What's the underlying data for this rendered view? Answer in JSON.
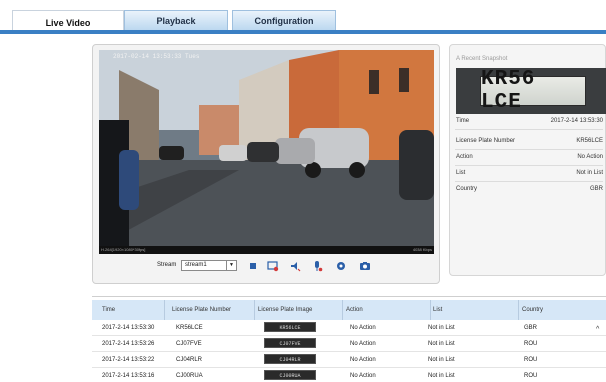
{
  "tabs": [
    {
      "label": "Live Video",
      "active": true
    },
    {
      "label": "Playback",
      "active": false
    },
    {
      "label": "Configuration",
      "active": false
    }
  ],
  "video": {
    "osd_timestamp": "2017-02-14 13:53:33 Tues",
    "stats_left": "H.264[1920×1080*30fps]",
    "stats_right": "4038 Kbps"
  },
  "toolbar": {
    "stream_label": "Stream",
    "stream_value": "stream1",
    "icons": [
      "stop-icon",
      "record-icon",
      "speaker-icon",
      "microphone-icon",
      "settings-icon",
      "camera-icon"
    ]
  },
  "snapshot": {
    "title": "A Recent Snapshot",
    "plate_text": "KR56 LCE",
    "fields": [
      {
        "key": "Time",
        "value": "2017-2-14 13:53:30"
      },
      {
        "key": "License Plate Number",
        "value": "KR56LCE"
      },
      {
        "key": "Action",
        "value": "No Action"
      },
      {
        "key": "List",
        "value": "Not in List"
      },
      {
        "key": "Country",
        "value": "GBR"
      }
    ]
  },
  "table": {
    "columns": [
      "Time",
      "License Plate Number",
      "License Plate Image",
      "Action",
      "List",
      "Country"
    ],
    "rows": [
      {
        "time": "2017-2-14 13:53:30",
        "plate": "KR56LCE",
        "image_text": "KR56LCE",
        "action": "No Action",
        "list": "Not in List",
        "country": "GBR"
      },
      {
        "time": "2017-2-14 13:53:26",
        "plate": "CJ07FVE",
        "image_text": "CJ07FVE",
        "action": "No Action",
        "list": "Not in List",
        "country": "ROU"
      },
      {
        "time": "2017-2-14 13:53:22",
        "plate": "CJ04RLR",
        "image_text": "CJ04RLR",
        "action": "No Action",
        "list": "Not in List",
        "country": "ROU"
      },
      {
        "time": "2017-2-14 13:53:16",
        "plate": "CJ00RUA",
        "image_text": "CJ00RUA",
        "action": "No Action",
        "list": "Not in List",
        "country": "ROU"
      }
    ]
  },
  "colors": {
    "accent": "#3a7fc4",
    "header_bg": "#d6e7f7"
  }
}
